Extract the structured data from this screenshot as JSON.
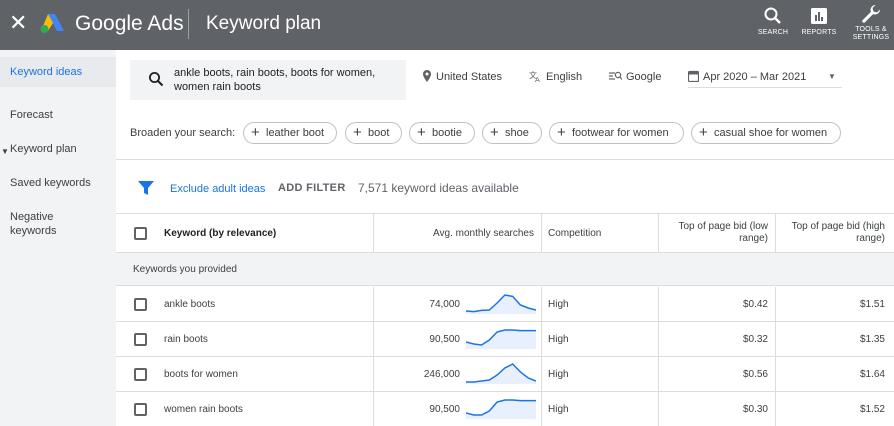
{
  "header": {
    "close_glyph": "✕",
    "brand": "Google Ads",
    "title": "Keyword plan",
    "actions": [
      {
        "label": "SEARCH",
        "icon": "search-icon"
      },
      {
        "label": "REPORTS",
        "icon": "reports-icon"
      },
      {
        "label_line1": "TOOLS &",
        "label_line2": "SETTINGS",
        "icon": "wrench-icon"
      }
    ]
  },
  "sidebar": {
    "items": [
      {
        "label": "Keyword ideas",
        "active": true
      },
      {
        "label": "Forecast"
      },
      {
        "label": "Keyword plan",
        "expanded": true
      },
      {
        "label": "Saved keywords"
      },
      {
        "label_line1": "Negative",
        "label_line2": "keywords"
      }
    ]
  },
  "search": {
    "line1": "ankle boots, rain boots, boots for women,",
    "line2": "women rain boots"
  },
  "filters": {
    "location": "United States",
    "language": "English",
    "network": "Google",
    "date_range": "Apr 2020 – Mar 2021"
  },
  "broaden": {
    "label": "Broaden your search:",
    "chips": [
      "leather boot",
      "boot",
      "bootie",
      "shoe",
      "footwear for women",
      "casual shoe for women"
    ]
  },
  "toolbar": {
    "exclude_link": "Exclude adult ideas",
    "add_filter": "ADD FILTER",
    "count_text": "7,571 keyword ideas available"
  },
  "table": {
    "headers": {
      "keyword": "Keyword (by relevance)",
      "searches": "Avg. monthly searches",
      "competition": "Competition",
      "low_bid_line1": "Top of page bid (low",
      "low_bid_line2": "range)",
      "high_bid_line1": "Top of page bid (high",
      "high_bid_line2": "range)"
    },
    "group_label": "Keywords you provided",
    "rows": [
      {
        "keyword": "ankle boots",
        "searches": "74,000",
        "competition": "High",
        "low_bid": "$0.42",
        "high_bid": "$1.51",
        "trend": [
          0.15,
          0.12,
          0.18,
          0.2,
          0.55,
          0.95,
          0.88,
          0.45,
          0.3,
          0.2
        ]
      },
      {
        "keyword": "rain boots",
        "searches": "90,500",
        "competition": "High",
        "low_bid": "$0.32",
        "high_bid": "$1.35",
        "trend": [
          0.35,
          0.25,
          0.2,
          0.45,
          0.85,
          0.95,
          0.95,
          0.92,
          0.92,
          0.92
        ]
      },
      {
        "keyword": "boots for women",
        "searches": "246,000",
        "competition": "High",
        "low_bid": "$0.56",
        "high_bid": "$1.64",
        "trend": [
          0.1,
          0.1,
          0.15,
          0.2,
          0.45,
          0.8,
          1.0,
          0.6,
          0.3,
          0.15
        ]
      },
      {
        "keyword": "women rain boots",
        "searches": "90,500",
        "competition": "High",
        "low_bid": "$0.30",
        "high_bid": "$1.52",
        "trend": [
          0.3,
          0.2,
          0.2,
          0.4,
          0.85,
          0.95,
          0.95,
          0.92,
          0.92,
          0.92
        ]
      }
    ]
  },
  "colors": {
    "header_bg": "#5f6368",
    "accent": "#1a73e8",
    "spark_line": "#1a73e8",
    "spark_fill": "#e8f0fe"
  }
}
